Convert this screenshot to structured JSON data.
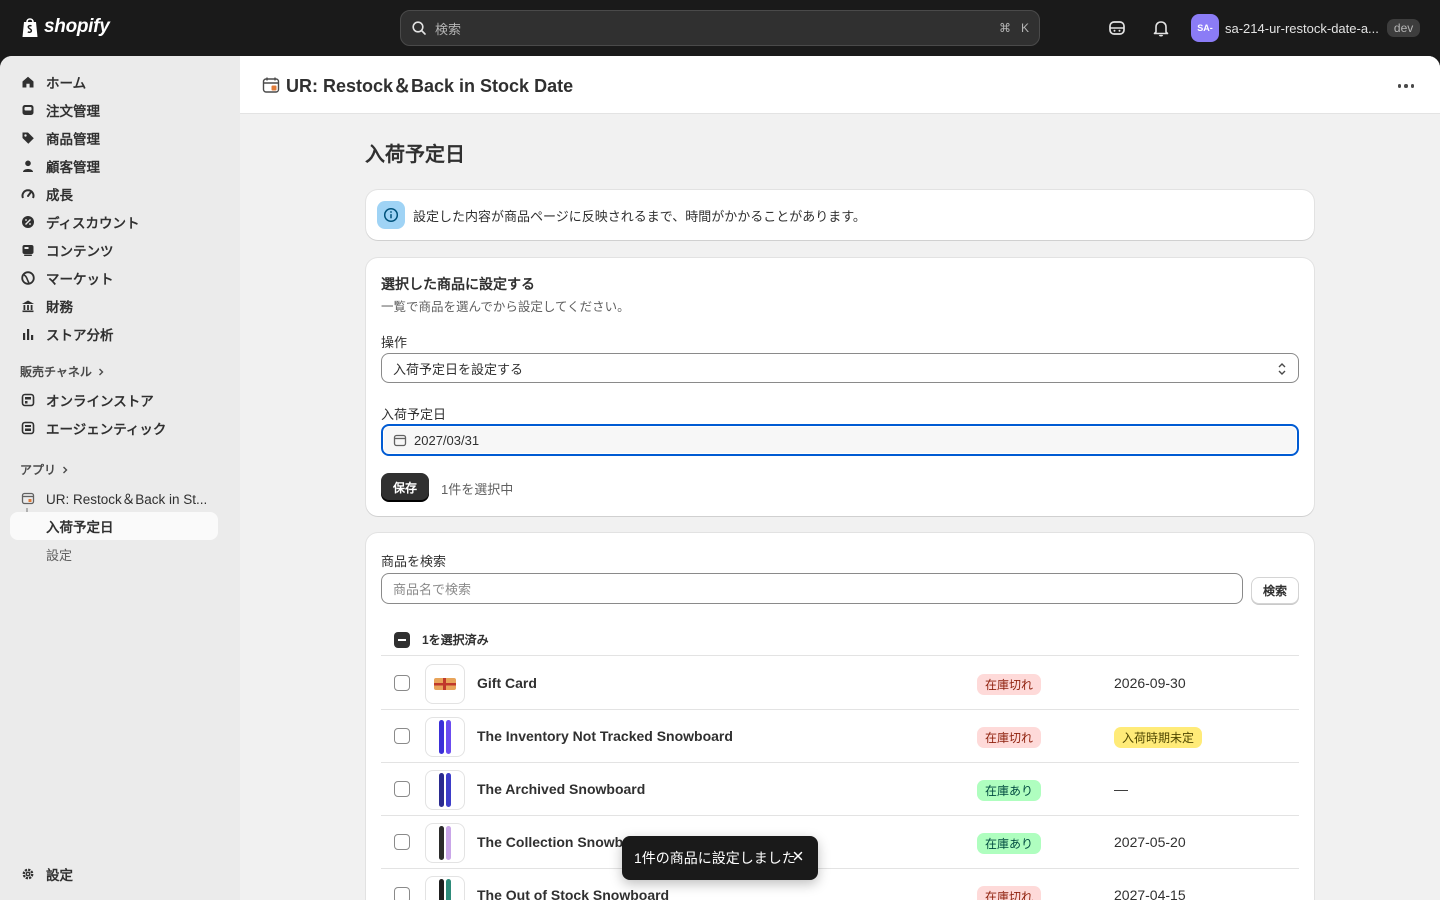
{
  "topbar": {
    "logo_text": "shopify",
    "search_placeholder": "検索",
    "shortcut_cmd": "⌘",
    "shortcut_key": "K",
    "avatar_initials": "SA-",
    "store_name": "sa-214-ur-restock-date-a...",
    "env_badge": "dev"
  },
  "sidebar": {
    "items": [
      {
        "label": "ホーム",
        "icon": "home-icon"
      },
      {
        "label": "注文管理",
        "icon": "inbox-icon"
      },
      {
        "label": "商品管理",
        "icon": "tag-icon"
      },
      {
        "label": "顧客管理",
        "icon": "person-icon"
      },
      {
        "label": "成長",
        "icon": "gauge-icon"
      },
      {
        "label": "ディスカウント",
        "icon": "discount-icon"
      },
      {
        "label": "コンテンツ",
        "icon": "content-icon"
      },
      {
        "label": "マーケット",
        "icon": "globe-icon"
      },
      {
        "label": "財務",
        "icon": "bank-icon"
      },
      {
        "label": "ストア分析",
        "icon": "chart-icon"
      }
    ],
    "sales_channels_label": "販売チャネル",
    "channels": [
      {
        "label": "オンラインストア",
        "icon": "store-icon"
      },
      {
        "label": "エージェンティック",
        "icon": "agent-icon"
      }
    ],
    "apps_label": "アプリ",
    "app_name": "UR: Restock＆Back in St...",
    "app_sub_active": "入荷予定日",
    "app_sub_settings": "設定",
    "settings_label": "設定"
  },
  "appbar": {
    "title": "UR: Restock＆Back in Stock Date"
  },
  "page": {
    "title": "入荷予定日",
    "banner": "設定した内容が商品ページに反映されるまで、時間がかかることがあります。"
  },
  "bulk_card": {
    "heading": "選択した商品に設定する",
    "subheading": "一覧で商品を選んでから設定してください。",
    "operation_label": "操作",
    "operation_value": "入荷予定日を設定する",
    "date_label": "入荷予定日",
    "date_value": "2027/03/31",
    "save_label": "保存",
    "selected_count": "1件を選択中"
  },
  "list_card": {
    "search_label": "商品を検索",
    "search_placeholder": "商品名で検索",
    "search_button": "検索",
    "bulk_label": "1を選択済み",
    "rows": [
      {
        "name": "Gift Card",
        "status": "在庫切れ",
        "status_type": "out",
        "date": "2026-09-30",
        "date_badge": ""
      },
      {
        "name": "The Inventory Not Tracked Snowboard",
        "status": "在庫切れ",
        "status_type": "out",
        "date": "",
        "date_badge": "入荷時期未定"
      },
      {
        "name": "The Archived Snowboard",
        "status": "在庫あり",
        "status_type": "in",
        "date": "—",
        "date_badge": ""
      },
      {
        "name": "The Collection Snowboard",
        "status": "在庫あり",
        "status_type": "in",
        "date": "2027-05-20",
        "date_badge": ""
      },
      {
        "name": "The Out of Stock Snowboard",
        "status": "在庫切れ",
        "status_type": "out",
        "date": "2027-04-15",
        "date_badge": ""
      }
    ]
  },
  "toast": {
    "message": "1件の商品に設定しました"
  },
  "colors": {
    "accent_focus": "#005bd3",
    "badge_out_bg": "#fedad9",
    "badge_in_bg": "#affebf",
    "badge_tbd_bg": "#ffeb78"
  }
}
